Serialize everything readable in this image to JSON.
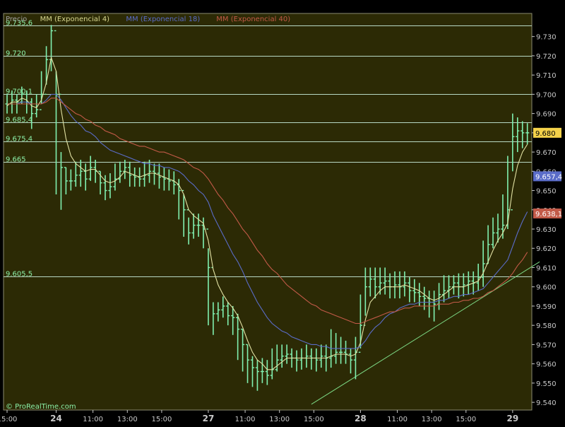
{
  "header": {
    "items": [
      {
        "label": "Precio",
        "color": "#a0a0a0"
      },
      {
        "label": "MM (Exponencial 4)",
        "color": "#d8d890"
      },
      {
        "label": "MM (Exponencial 18)",
        "color": "#5a6cc8"
      },
      {
        "label": "MM (Exponencial 40)",
        "color": "#c25a48"
      }
    ]
  },
  "watermark": "© ProRealTime.com",
  "colors": {
    "panel_bg": "#2c2a05",
    "outer_bg": "#000000",
    "price_bar": "#80f0b0",
    "ema4": "#e2e2a4",
    "ema18": "#5a6cc8",
    "ema40": "#c25a48",
    "hline": "#b8d8c4",
    "label_text": "#8cf0a8",
    "axis_text": "#c8c8c8",
    "trendline": "#7cd884",
    "tag_current_bg": "#f4d24a",
    "tag_ema18_bg": "#5a6cc8",
    "tag_ema40_bg": "#c25a48"
  },
  "chart_data": {
    "type": "bar",
    "y_axis": {
      "min": 9.536,
      "max": 9.742,
      "ticks": [
        "9.730",
        "9.720",
        "9.710",
        "9.700",
        "9.690",
        "9.680",
        "9.670",
        "9.660",
        "9.650",
        "9.640",
        "9.630",
        "9.620",
        "9.610",
        "9.600",
        "9.590",
        "9.580",
        "9.570",
        "9.560",
        "9.550",
        "9.540"
      ]
    },
    "x_axis": {
      "ticks": [
        {
          "label": "15:00",
          "pos": 0.0
        },
        {
          "label": "24",
          "pos": 10.0
        },
        {
          "label": "11:00",
          "pos": 17.5
        },
        {
          "label": "13:00",
          "pos": 24.5
        },
        {
          "label": "15:00",
          "pos": 31.5
        },
        {
          "label": "27",
          "pos": 41.0
        },
        {
          "label": "11:00",
          "pos": 48.5
        },
        {
          "label": "13:00",
          "pos": 55.5
        },
        {
          "label": "15:00",
          "pos": 62.5
        },
        {
          "label": "28",
          "pos": 72.0
        },
        {
          "label": "11:00",
          "pos": 79.5
        },
        {
          "label": "13:00",
          "pos": 86.5
        },
        {
          "label": "15:00",
          "pos": 93.5
        },
        {
          "label": "29",
          "pos": 103.0
        }
      ],
      "bold_labels": [
        "24",
        "27",
        "28",
        "29"
      ]
    },
    "horizontal_lines": [
      {
        "label": "9.735,6",
        "value": 9.7356
      },
      {
        "label": "9.720",
        "value": 9.72
      },
      {
        "label": "9.700,1",
        "value": 9.7001
      },
      {
        "label": "9.685,4",
        "value": 9.6854
      },
      {
        "label": "9.675,4",
        "value": 9.6754
      },
      {
        "label": "9.665",
        "value": 9.665
      },
      {
        "label": "9.605,5",
        "value": 9.6055
      }
    ],
    "price_tags": [
      {
        "label": "9.680",
        "value": 9.68,
        "kind": "current"
      },
      {
        "label": "9.657,4",
        "value": 9.6574,
        "kind": "ema18"
      },
      {
        "label": "9.638,1",
        "value": 9.6381,
        "kind": "ema40"
      }
    ],
    "trendline": {
      "x1": 62.0,
      "y1": 9.539,
      "x2": 108.5,
      "y2": 9.613
    },
    "series": [
      {
        "name": "Precio",
        "close": [
          9.695,
          9.697,
          9.696,
          9.7,
          9.696,
          9.69,
          9.692,
          9.7,
          9.718,
          9.733,
          9.7,
          9.662,
          9.655,
          9.655,
          9.658,
          9.66,
          9.656,
          9.662,
          9.66,
          9.654,
          9.65,
          9.652,
          9.656,
          9.66,
          9.662,
          9.658,
          9.657,
          9.656,
          9.658,
          9.66,
          9.659,
          9.657,
          9.656,
          9.655,
          9.653,
          9.65,
          9.64,
          9.628,
          9.632,
          9.632,
          9.63,
          9.61,
          9.586,
          9.588,
          9.59,
          9.585,
          9.584,
          9.578,
          9.57,
          9.562,
          9.558,
          9.556,
          9.556,
          9.554,
          9.557,
          9.562,
          9.564,
          9.565,
          9.563,
          9.562,
          9.563,
          9.564,
          9.563,
          9.562,
          9.564,
          9.563,
          9.564,
          9.566,
          9.566,
          9.565,
          9.562,
          9.566,
          9.58,
          9.6,
          9.604,
          9.6,
          9.602,
          9.603,
          9.6,
          9.601,
          9.6,
          9.602,
          9.598,
          9.597,
          9.595,
          9.594,
          9.592,
          9.591,
          9.596,
          9.598,
          9.6,
          9.602,
          9.6,
          9.601,
          9.603,
          9.602,
          9.605,
          9.612,
          9.622,
          9.628,
          9.63,
          9.632,
          9.64,
          9.678,
          9.681,
          9.68,
          9.68
        ],
        "high": [
          9.7,
          9.702,
          9.7,
          9.704,
          9.702,
          9.698,
          9.7,
          9.712,
          9.725,
          9.736,
          9.712,
          9.67,
          9.662,
          9.661,
          9.665,
          9.666,
          9.664,
          9.668,
          9.666,
          9.66,
          9.658,
          9.659,
          9.664,
          9.665,
          9.666,
          9.665,
          9.662,
          9.662,
          9.665,
          9.666,
          9.664,
          9.664,
          9.662,
          9.661,
          9.66,
          9.656,
          9.648,
          9.636,
          9.638,
          9.638,
          9.636,
          9.62,
          9.592,
          9.592,
          9.595,
          9.592,
          9.59,
          9.586,
          9.578,
          9.57,
          9.564,
          9.562,
          9.563,
          9.562,
          9.568,
          9.57,
          9.57,
          9.57,
          9.568,
          9.567,
          9.568,
          9.57,
          9.568,
          9.568,
          9.57,
          9.57,
          9.578,
          9.576,
          9.574,
          9.572,
          9.568,
          9.574,
          9.596,
          9.61,
          9.61,
          9.61,
          9.61,
          9.61,
          9.607,
          9.608,
          9.608,
          9.608,
          9.605,
          9.604,
          9.602,
          9.6,
          9.598,
          9.598,
          9.602,
          9.606,
          9.606,
          9.606,
          9.607,
          9.607,
          9.608,
          9.608,
          9.612,
          9.624,
          9.632,
          9.636,
          9.638,
          9.648,
          9.668,
          9.69,
          9.688,
          9.686,
          9.685
        ],
        "low": [
          9.69,
          9.69,
          9.69,
          9.695,
          9.69,
          9.682,
          9.688,
          9.695,
          9.705,
          9.712,
          9.648,
          9.64,
          9.648,
          9.65,
          9.652,
          9.652,
          9.65,
          9.655,
          9.654,
          9.648,
          9.645,
          9.646,
          9.65,
          9.654,
          9.656,
          9.652,
          9.652,
          9.652,
          9.652,
          9.654,
          9.653,
          9.651,
          9.65,
          9.65,
          9.648,
          9.635,
          9.626,
          9.622,
          9.625,
          9.626,
          9.62,
          9.58,
          9.575,
          9.582,
          9.584,
          9.58,
          9.575,
          9.562,
          9.556,
          9.55,
          9.548,
          9.546,
          9.55,
          9.549,
          9.552,
          9.556,
          9.558,
          9.56,
          9.558,
          9.556,
          9.557,
          9.558,
          9.557,
          9.556,
          9.558,
          9.556,
          9.558,
          9.56,
          9.56,
          9.56,
          9.555,
          9.552,
          9.568,
          9.585,
          9.595,
          9.594,
          9.596,
          9.596,
          9.594,
          9.594,
          9.594,
          9.595,
          9.592,
          9.592,
          9.59,
          9.588,
          9.584,
          9.582,
          9.588,
          9.592,
          9.594,
          9.596,
          9.594,
          9.595,
          9.596,
          9.596,
          9.598,
          9.6,
          9.612,
          9.62,
          9.623,
          9.625,
          9.63,
          9.66,
          9.67,
          9.672,
          9.674
        ]
      },
      {
        "name": "MM (Exponencial 4)",
        "values": [
          9.694,
          9.696,
          9.696,
          9.698,
          9.697,
          9.694,
          9.693,
          9.697,
          9.706,
          9.719,
          9.712,
          9.692,
          9.677,
          9.668,
          9.664,
          9.662,
          9.66,
          9.661,
          9.661,
          9.658,
          9.655,
          9.654,
          9.655,
          9.657,
          9.66,
          9.659,
          9.658,
          9.657,
          9.658,
          9.659,
          9.659,
          9.658,
          9.657,
          9.656,
          9.655,
          9.653,
          9.648,
          9.64,
          9.637,
          9.635,
          9.633,
          9.624,
          9.609,
          9.601,
          9.596,
          9.592,
          9.589,
          9.585,
          9.579,
          9.572,
          9.566,
          9.562,
          9.56,
          9.557,
          9.557,
          9.559,
          9.561,
          9.563,
          9.563,
          9.563,
          9.563,
          9.563,
          9.563,
          9.563,
          9.563,
          9.563,
          9.564,
          9.565,
          9.565,
          9.565,
          9.564,
          9.565,
          9.571,
          9.583,
          9.592,
          9.595,
          9.598,
          9.6,
          9.6,
          9.6,
          9.6,
          9.601,
          9.6,
          9.599,
          9.598,
          9.596,
          9.594,
          9.593,
          9.594,
          9.596,
          9.598,
          9.6,
          9.6,
          9.6,
          9.601,
          9.602,
          9.603,
          9.607,
          9.613,
          9.619,
          9.624,
          9.628,
          9.633,
          9.651,
          9.663,
          9.67,
          9.674
        ]
      },
      {
        "name": "MM (Exponencial 18)",
        "values": [
          9.695,
          9.695,
          9.695,
          9.696,
          9.696,
          9.695,
          9.695,
          9.695,
          9.697,
          9.7,
          9.7,
          9.697,
          9.693,
          9.689,
          9.686,
          9.684,
          9.681,
          9.68,
          9.678,
          9.675,
          9.673,
          9.671,
          9.67,
          9.669,
          9.668,
          9.667,
          9.666,
          9.665,
          9.664,
          9.664,
          9.663,
          9.663,
          9.662,
          9.662,
          9.661,
          9.66,
          9.658,
          9.655,
          9.653,
          9.65,
          9.648,
          9.644,
          9.637,
          9.632,
          9.627,
          9.622,
          9.617,
          9.613,
          9.608,
          9.602,
          9.597,
          9.592,
          9.588,
          9.584,
          9.581,
          9.579,
          9.577,
          9.576,
          9.574,
          9.573,
          9.572,
          9.571,
          9.57,
          9.57,
          9.569,
          9.569,
          9.568,
          9.568,
          9.568,
          9.568,
          9.568,
          9.568,
          9.569,
          9.572,
          9.576,
          9.579,
          9.581,
          9.584,
          9.586,
          9.587,
          9.589,
          9.59,
          9.591,
          9.591,
          9.592,
          9.592,
          9.592,
          9.592,
          9.593,
          9.593,
          9.594,
          9.595,
          9.595,
          9.596,
          9.596,
          9.597,
          9.598,
          9.599,
          9.602,
          9.605,
          9.608,
          9.611,
          9.614,
          9.621,
          9.628,
          9.634,
          9.639
        ]
      },
      {
        "name": "MM (Exponencial 40)",
        "values": [
          9.695,
          9.695,
          9.695,
          9.695,
          9.695,
          9.695,
          9.695,
          9.695,
          9.696,
          9.698,
          9.698,
          9.696,
          9.694,
          9.692,
          9.69,
          9.689,
          9.687,
          9.686,
          9.684,
          9.683,
          9.681,
          9.68,
          9.679,
          9.677,
          9.676,
          9.675,
          9.674,
          9.673,
          9.673,
          9.672,
          9.671,
          9.67,
          9.67,
          9.669,
          9.668,
          9.667,
          9.666,
          9.664,
          9.662,
          9.661,
          9.659,
          9.656,
          9.652,
          9.648,
          9.645,
          9.641,
          9.638,
          9.634,
          9.63,
          9.627,
          9.623,
          9.619,
          9.616,
          9.612,
          9.609,
          9.607,
          9.604,
          9.601,
          9.599,
          9.597,
          9.595,
          9.593,
          9.591,
          9.59,
          9.588,
          9.587,
          9.586,
          9.585,
          9.584,
          9.583,
          9.582,
          9.581,
          9.581,
          9.582,
          9.583,
          9.584,
          9.585,
          9.586,
          9.587,
          9.587,
          9.588,
          9.589,
          9.589,
          9.59,
          9.59,
          9.59,
          9.59,
          9.59,
          9.591,
          9.591,
          9.591,
          9.592,
          9.592,
          9.593,
          9.593,
          9.594,
          9.594,
          9.595,
          9.597,
          9.598,
          9.6,
          9.602,
          9.604,
          9.607,
          9.611,
          9.614,
          9.618
        ]
      }
    ]
  }
}
